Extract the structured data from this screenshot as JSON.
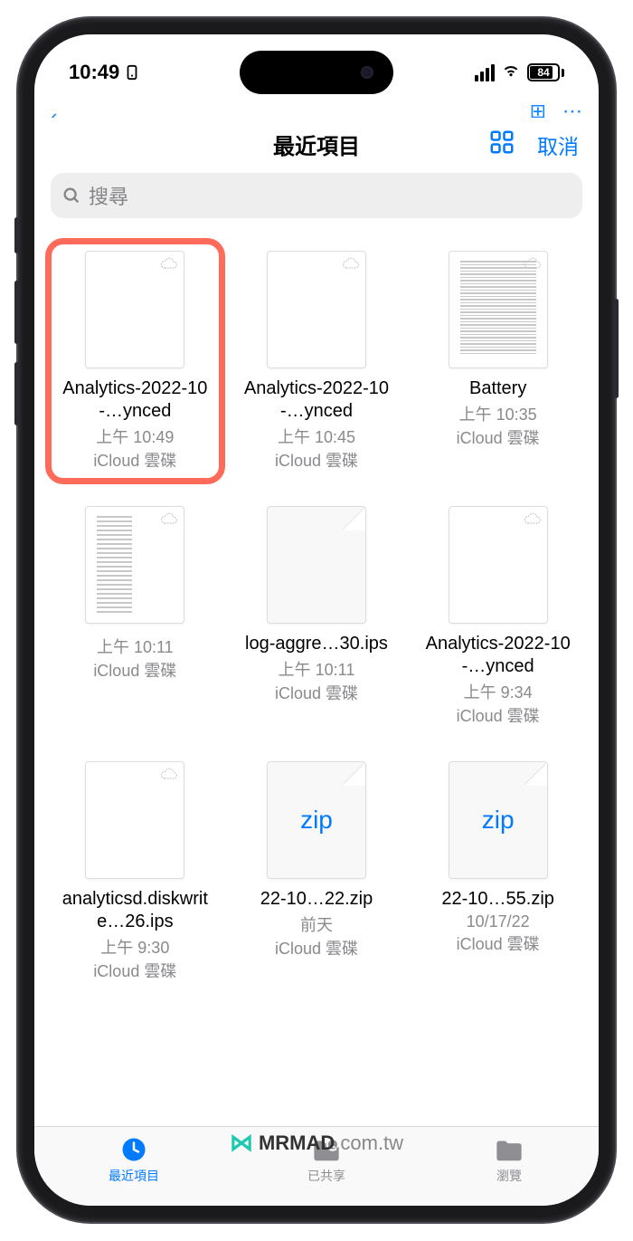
{
  "status": {
    "time": "10:49",
    "battery": "84"
  },
  "header": {
    "title": "最近項目",
    "cancel": "取消"
  },
  "search": {
    "placeholder": "搜尋"
  },
  "files": [
    {
      "name": "Analytics-2022-10-…ynced",
      "time": "上午 10:49",
      "loc": "iCloud 雲碟",
      "type": "blank",
      "cloud": true,
      "highlight": true
    },
    {
      "name": "Analytics-2022-10-…ynced",
      "time": "上午 10:45",
      "loc": "iCloud 雲碟",
      "type": "blank",
      "cloud": true
    },
    {
      "name": "Battery",
      "time": "上午 10:35",
      "loc": "iCloud 雲碟",
      "type": "dense-text",
      "cloud": true
    },
    {
      "name": "",
      "time": "上午 10:11",
      "loc": "iCloud 雲碟",
      "type": "sparse-text",
      "cloud": true
    },
    {
      "name": "log-aggre…30.ips",
      "time": "上午 10:11",
      "loc": "iCloud 雲碟",
      "type": "page"
    },
    {
      "name": "Analytics-2022-10-…ynced",
      "time": "上午 9:34",
      "loc": "iCloud 雲碟",
      "type": "blank",
      "cloud": true
    },
    {
      "name": "analyticsd.diskwrite…26.ips",
      "time": "上午 9:30",
      "loc": "iCloud 雲碟",
      "type": "blank",
      "cloud": true
    },
    {
      "name": "22-10…22.zip",
      "time": "前天",
      "loc": "iCloud 雲碟",
      "type": "zip"
    },
    {
      "name": "22-10…55.zip",
      "time": "10/17/22",
      "loc": "iCloud 雲碟",
      "type": "zip"
    }
  ],
  "tabs": [
    {
      "label": "最近項目",
      "icon": "clock",
      "active": true
    },
    {
      "label": "已共享",
      "icon": "shared-folder"
    },
    {
      "label": "瀏覽",
      "icon": "folder"
    }
  ],
  "watermark": {
    "brand": "MRMAD",
    "domain": ".com.tw"
  }
}
